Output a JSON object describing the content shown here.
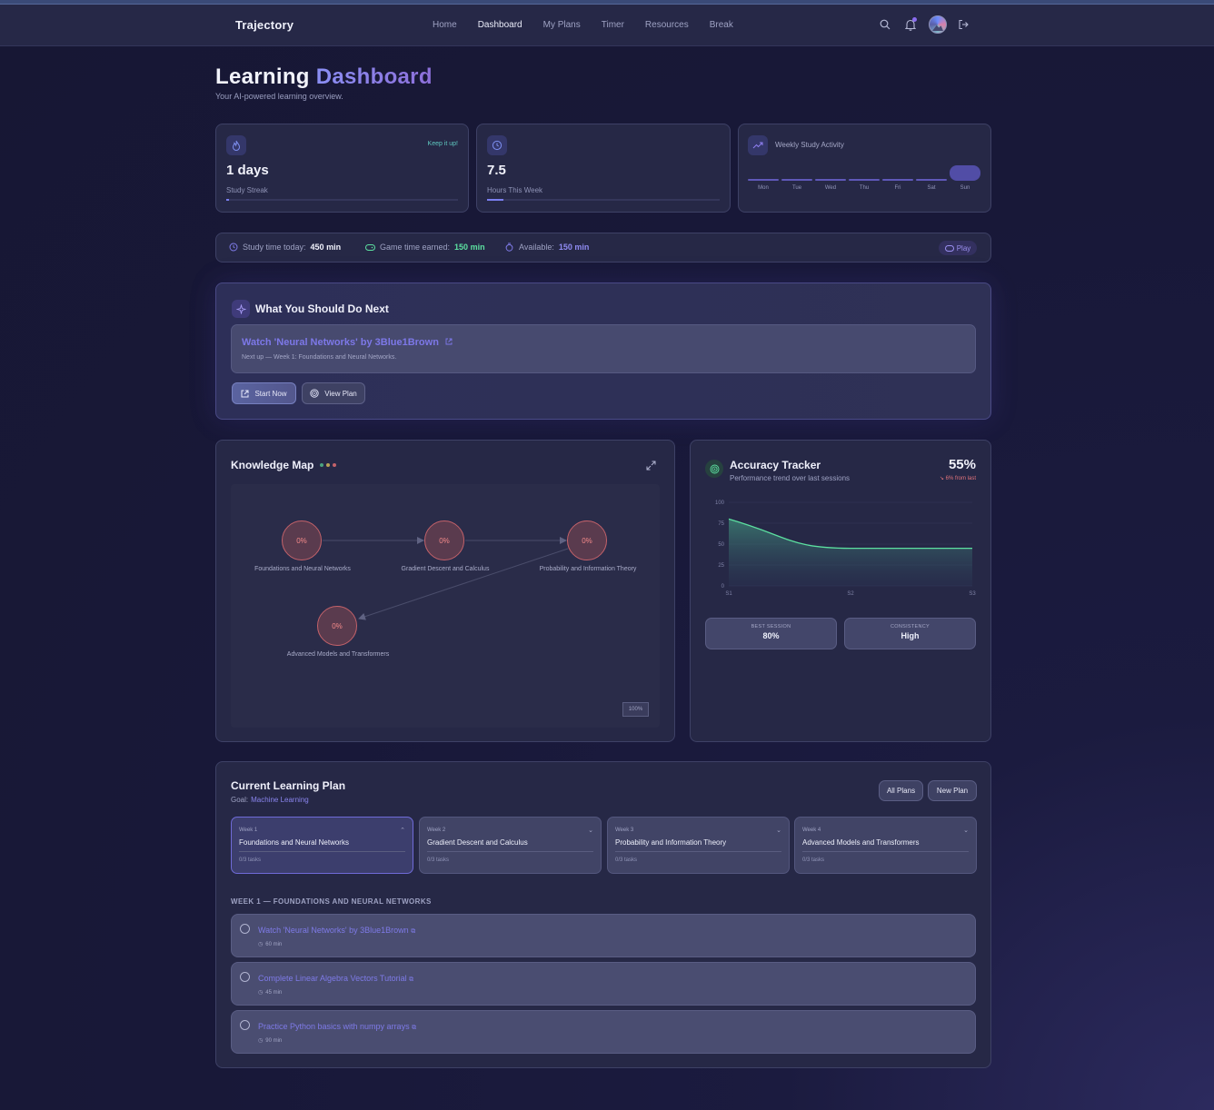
{
  "nav": {
    "brand": "Trajectory",
    "links": [
      "Home",
      "Dashboard",
      "My Plans",
      "Timer",
      "Resources",
      "Break"
    ],
    "active": "Dashboard"
  },
  "header": {
    "title_main": "Learning",
    "title_accent": "Dashboard",
    "subtitle": "Your AI-powered learning overview."
  },
  "streak": {
    "value": "1 days",
    "label": "Study Streak",
    "note": "Keep it up!",
    "progress": 0.01
  },
  "hours": {
    "value": "7.5",
    "label": "Hours This Week",
    "progress": 0.07
  },
  "weekly": {
    "title": "Weekly Study Activity",
    "days": [
      "Mon",
      "Tue",
      "Wed",
      "Thu",
      "Fri",
      "Sat",
      "Sun"
    ],
    "highlight": "Sun"
  },
  "timebar": {
    "study_label": "Study time today:",
    "study_value": "450 min",
    "game_label": "Game time earned:",
    "game_value": "150 min",
    "avail_label": "Available:",
    "avail_value": "150 min",
    "play_label": "Play"
  },
  "next": {
    "title": "What You Should Do Next",
    "task": "Watch 'Neural Networks' by 3Blue1Brown",
    "sub": "Next up — Week 1: Foundations and Neural Networks.",
    "start_label": "Start Now",
    "view_label": "View Plan"
  },
  "kmap": {
    "title": "Knowledge Map",
    "nodes": [
      {
        "pct": "0%",
        "label": "Foundations and Neural Networks"
      },
      {
        "pct": "0%",
        "label": "Gradient Descent and Calculus"
      },
      {
        "pct": "0%",
        "label": "Probability and Information Theory"
      },
      {
        "pct": "0%",
        "label": "Advanced Models and Transformers"
      }
    ],
    "zoom": "100%"
  },
  "accuracy": {
    "title": "Accuracy Tracker",
    "subtitle": "Performance trend over last sessions",
    "value": "55%",
    "delta": "6% from last",
    "best_label": "BEST SESSION",
    "best_value": "80%",
    "cons_label": "CONSISTENCY",
    "cons_value": "High"
  },
  "chart_data": {
    "type": "area",
    "x": [
      "S1",
      "S2",
      "S3"
    ],
    "y_ticks": [
      0,
      25,
      50,
      75,
      100
    ],
    "ylim": [
      0,
      100
    ],
    "series": [
      {
        "values": [
          80,
          45,
          45
        ]
      }
    ]
  },
  "plan": {
    "title": "Current Learning Plan",
    "goal_label": "Goal:",
    "goal": "Machine Learning",
    "all_label": "All Plans",
    "new_label": "New Plan",
    "weeks": [
      {
        "n": "Week 1",
        "name": "Foundations and Neural Networks",
        "tasks": "0/3 tasks"
      },
      {
        "n": "Week 2",
        "name": "Gradient Descent and Calculus",
        "tasks": "0/3 tasks"
      },
      {
        "n": "Week 3",
        "name": "Probability and Information Theory",
        "tasks": "0/3 tasks"
      },
      {
        "n": "Week 4",
        "name": "Advanced Models and Transformers",
        "tasks": "0/3 tasks"
      }
    ],
    "section": "WEEK 1 — FOUNDATIONS AND NEURAL NETWORKS",
    "items": [
      {
        "title": "Watch 'Neural Networks' by 3Blue1Brown",
        "dur": "60 min"
      },
      {
        "title": "Complete Linear Algebra Vectors Tutorial",
        "dur": "45 min"
      },
      {
        "title": "Practice Python basics with numpy arrays",
        "dur": "90 min"
      }
    ]
  },
  "colors": {
    "accent": "#7d78e8",
    "green": "#5ce0a0",
    "danger": "#e3747c"
  }
}
